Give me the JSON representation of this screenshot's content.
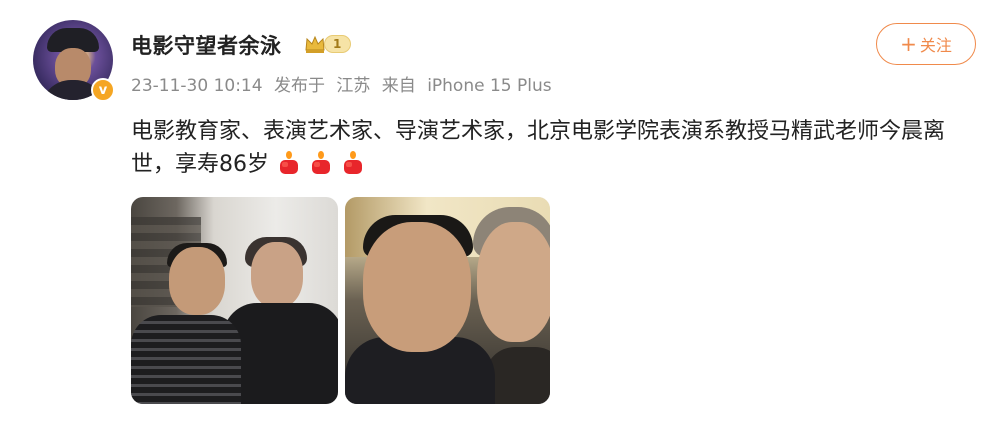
{
  "user": {
    "name": "电影守望者余泳",
    "level": "1",
    "verified_symbol": "v"
  },
  "meta": {
    "date": "23-11-30 10:14",
    "posted_at_label": "发布于",
    "location": "江苏",
    "source_label": "来自",
    "device": "iPhone 15 Plus"
  },
  "follow_button": {
    "plus": "+",
    "label": "关注"
  },
  "post": {
    "text": "电影教育家、表演艺术家、导演艺术家，北京电影学院表演系教授马精武老师今晨离世，享寿86岁",
    "emoji_count": 3,
    "emoji_icon": "candle-icon"
  },
  "photos": [
    {
      "subject": "photo-1"
    },
    {
      "subject": "photo-2"
    }
  ],
  "colors": {
    "accent": "#f08a4b",
    "meta_text": "#8a8a8a",
    "level_gold": "#a27a18"
  }
}
